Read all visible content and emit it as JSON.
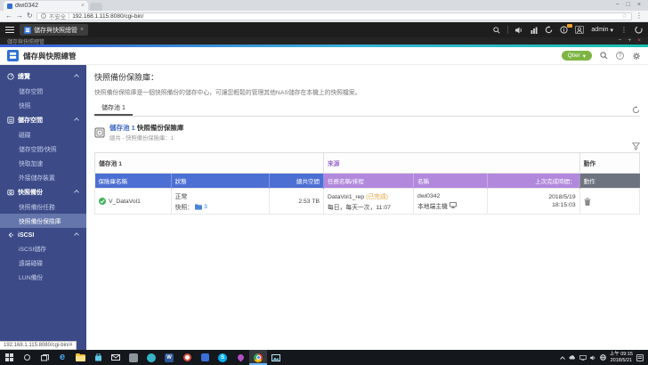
{
  "browser": {
    "tab_title": "dwi0342",
    "security_label": "不安全",
    "url": "192.168.1.115:8080/cgi-bin/",
    "status_link": "192.168.1.115:8080/cgi-bin/#"
  },
  "qts": {
    "app_tab_label": "儲存與快照總管",
    "window_title": "儲存與快照總管",
    "username": "admin"
  },
  "header": {
    "app_title": "儲存與快照總管",
    "qtier_label": "Qtier"
  },
  "sidebar": {
    "sections": [
      {
        "label": "總覽",
        "items": [
          {
            "label": "儲存空間"
          },
          {
            "label": "快照"
          }
        ]
      },
      {
        "label": "儲存空間",
        "items": [
          {
            "label": "磁碟"
          },
          {
            "label": "儲存空間/快照"
          },
          {
            "label": "快取加速"
          },
          {
            "label": "外接儲存裝置"
          }
        ]
      },
      {
        "label": "快照備份",
        "items": [
          {
            "label": "快照備份任務"
          },
          {
            "label": "快照備份保險庫"
          }
        ]
      },
      {
        "label": "iSCSI",
        "items": [
          {
            "label": "iSCSI儲存"
          },
          {
            "label": "遠端磁碟"
          },
          {
            "label": "LUN備份"
          }
        ]
      }
    ],
    "selected_item": "快照備份保險庫"
  },
  "content": {
    "heading": "快照備份保險庫：",
    "description": "快照備份保險庫是一個快照備份的儲存中心，可讓您輕鬆的管理其他NAS儲存在本機上的快照檔案。",
    "pool_tab": "儲存池 1",
    "panel": {
      "title_pool": "儲存池 1",
      "title_rest": "快照備份保險庫",
      "subtitle": "總共 - 快照備份保險庫：1"
    },
    "table": {
      "groups": {
        "pool": "儲存池 1",
        "source": "來源",
        "action": "動作"
      },
      "columns": [
        "保險庫名稱",
        "狀態",
        "總共空間",
        "任務名稱/排程",
        "名稱",
        "上次完成時間：",
        "動作"
      ],
      "row": {
        "vault_name": "V_DataVol1",
        "status": "正常",
        "snapshot_label": "快照：",
        "snapshot_count": "3",
        "total_size": "2.53 TB",
        "task_name": "DataVol1_rep",
        "task_state": "(已完成)",
        "schedule": "每日，每天一次，11:07",
        "source_name": "dwi0342",
        "source_host": "本地端主機",
        "last_date": "2018/5/19",
        "last_time": "18:15:03"
      }
    }
  },
  "taskbar": {
    "clock_time": "上午 09:15",
    "clock_date": "2018/5/21"
  },
  "glyphs": {
    "close": "×",
    "minimize": "−",
    "maximize": "□",
    "plus": "+",
    "back": "←",
    "forward": "→",
    "reload": "↻",
    "star": "☆",
    "menu_dots": "⋮",
    "caret_down": "▾",
    "question": "?",
    "edge": "e",
    "word": "W",
    "skype": "S"
  },
  "colors": {
    "accent_gradient_start": "#3a5fd9",
    "accent_gradient_end": "#17c2b0",
    "sidebar_bg": "#3c4b88",
    "table_header_blue": "#4c6fd3",
    "table_header_purple": "#b288dd",
    "table_header_gray": "#6e7380",
    "qtier_green": "#7db544",
    "link_blue": "#2f7fd4",
    "done_orange": "#e8a33d",
    "ok_green": "#43b05c"
  }
}
